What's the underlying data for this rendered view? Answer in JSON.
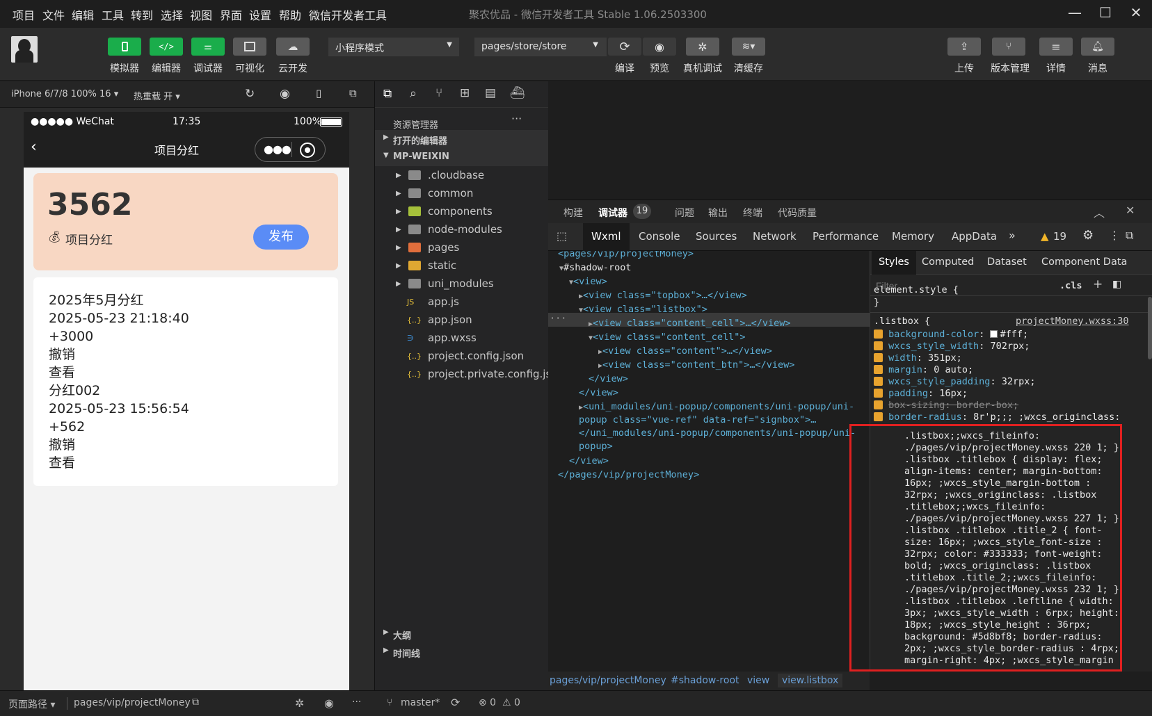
{
  "menu": [
    "项目",
    "文件",
    "编辑",
    "工具",
    "转到",
    "选择",
    "视图",
    "界面",
    "设置",
    "帮助",
    "微信开发者工具"
  ],
  "window_title": "聚农优品 - 微信开发者工具 Stable 1.06.2503300",
  "toolbar": {
    "simulator": "模拟器",
    "editor": "编辑器",
    "debugger": "调试器",
    "visual": "可视化",
    "cloud": "云开发",
    "mode_select": "小程序模式",
    "page_select": "pages/store/store",
    "compile": "编译",
    "preview": "预览",
    "remote_debug": "真机调试",
    "clear_cache": "清缓存",
    "upload": "上传",
    "version": "版本管理",
    "details": "详情",
    "messages": "消息"
  },
  "sim": {
    "device": "iPhone 6/7/8 100% 16",
    "hot_reload": "热重载 开"
  },
  "phone": {
    "carrier": "●●●●● WeChat",
    "time": "17:35",
    "battery": "100%",
    "title": "项目分红",
    "amount": "3562",
    "subtitle": "项目分红",
    "publish": "发布",
    "list": [
      "2025年5月分红",
      "2025-05-23 21:18:40",
      "+3000",
      "撤销",
      "查看",
      "分红002",
      "2025-05-23 15:56:54",
      "+562",
      "撤销",
      "查看"
    ]
  },
  "explorer": {
    "title": "资源管理器",
    "open_editors": "打开的编辑器",
    "root": "MP-WEIXIN",
    "folders": [
      ".cloudbase",
      "common",
      "components",
      "node-modules",
      "pages",
      "static",
      "uni_modules"
    ],
    "files": [
      "app.js",
      "app.json",
      "app.wxss",
      "project.config.json",
      "project.private.config.js..."
    ],
    "outline": "大纲",
    "timeline": "时间线"
  },
  "devtools": {
    "top_tabs": [
      "构建",
      "调试器",
      "问题",
      "输出",
      "终端",
      "代码质量"
    ],
    "debugger_count": "19",
    "panel_tabs": [
      "Wxml",
      "Console",
      "Sources",
      "Network",
      "Performance",
      "Memory",
      "AppData"
    ],
    "warn_count": "19",
    "style_tabs": [
      "Styles",
      "Computed",
      "Dataset",
      "Component Data"
    ],
    "filter_placeholder": "Filter",
    "cls": ".cls",
    "dom": [
      "<pages/vip/projectMoney>",
      "#shadow-root",
      "<view>",
      "<view class=\"topbox\">…</view>",
      "<view class=\"listbox\">",
      "<view class=\"content_cell\">…</view>",
      "<view class=\"content_cell\">",
      "<view class=\"content\">…</view>",
      "<view class=\"content_btn\">…</view>",
      "</view>",
      "</view>",
      "<uni_modules/uni-popup/components/uni-popup/uni-",
      "popup class=\"vue-ref\" data-ref=\"signbox\">…",
      "</uni_modules/uni-popup/components/uni-popup/uni-",
      "popup>",
      "</view>",
      "</pages/vip/projectMoney>"
    ],
    "styles": {
      "element_style": "element.style {",
      "close": "}",
      "selector": ".listbox {",
      "source": "projectMoney.wxss:30",
      "props": [
        [
          "background-color",
          "#fff;"
        ],
        [
          "wxcs_style_width",
          "702rpx;"
        ],
        [
          "width",
          "351px;"
        ],
        [
          "margin",
          "0 auto;"
        ],
        [
          "wxcs_style_padding",
          "32rpx;"
        ],
        [
          "padding",
          "16px;"
        ],
        [
          "box-sizing",
          "border-box;"
        ],
        [
          "border-radius",
          "8r'p;;; ;wxcs_originclass:"
        ]
      ],
      "wrap": [
        ".listbox;;wxcs_fileinfo:",
        "./pages/vip/projectMoney.wxss 220 1; }",
        ".listbox .titlebox { display: flex;",
        "align-items: center; margin-bottom:",
        "16px; ;wxcs_style_margin-bottom :",
        "32rpx; ;wxcs_originclass: .listbox",
        ".titlebox;;wxcs_fileinfo:",
        "./pages/vip/projectMoney.wxss 227 1; }",
        ".listbox .titlebox .title_2 { font-",
        "size: 16px; ;wxcs_style_font-size :",
        "32rpx; color: #333333; font-weight:",
        "bold; ;wxcs_originclass: .listbox",
        ".titlebox .title_2;;wxcs_fileinfo:",
        "./pages/vip/projectMoney.wxss 232 1; }",
        ".listbox .titlebox .leftline { width:",
        "3px; ;wxcs_style_width : 6rpx; height:",
        "18px; ;wxcs_style_height : 36rpx;",
        "background: #5d8bf8; border-radius:",
        "2px; ;wxcs_style_border-radius : 4rpx;",
        "margin-right: 4px; ;wxcs_style_margin"
      ]
    },
    "breadcrumb": [
      "pages/vip/projectMoney",
      "#shadow-root",
      "view",
      "view.listbox"
    ]
  },
  "footer": {
    "path_label": "页面路径",
    "path": "pages/vip/projectMoney",
    "branch": "master*",
    "errors": "⊗ 0",
    "warnings": "⚠ 0"
  },
  "colors": {
    "accent_green": "#1aad4b",
    "publish_blue": "#5a8cf6",
    "highlight_red": "#e02020"
  }
}
